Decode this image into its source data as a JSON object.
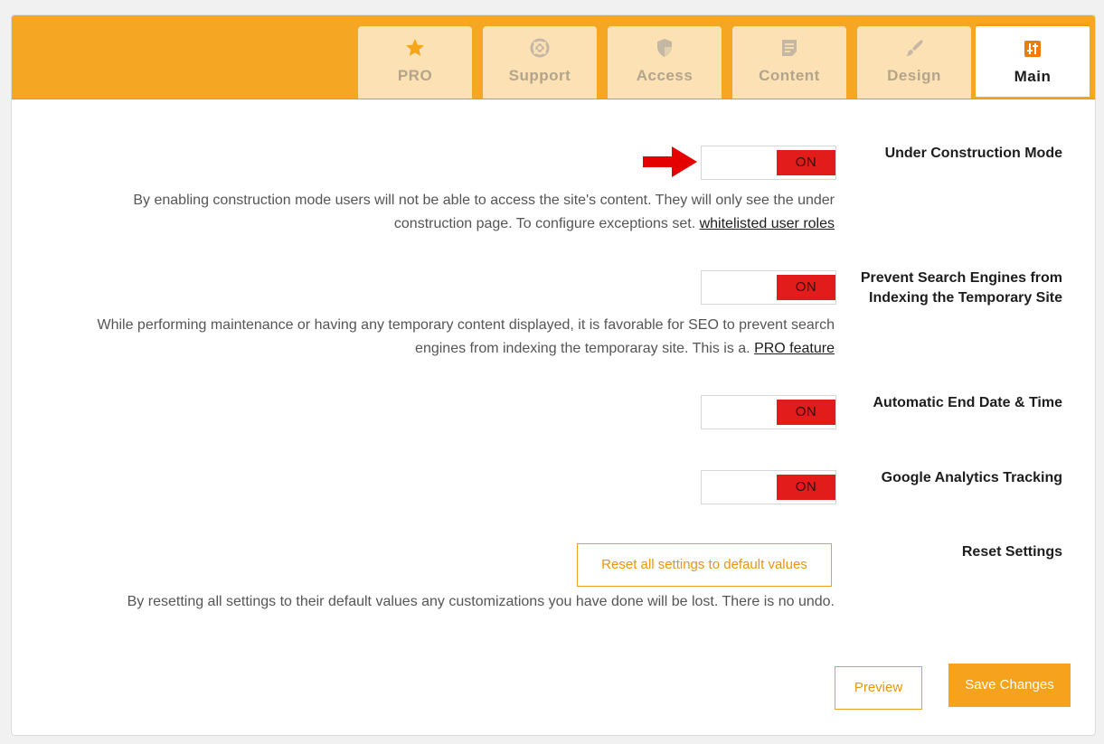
{
  "tabs": [
    {
      "label": "PRO",
      "icon": "star-icon"
    },
    {
      "label": "Support",
      "icon": "lifebuoy-icon"
    },
    {
      "label": "Access",
      "icon": "shield-icon"
    },
    {
      "label": "Content",
      "icon": "document-icon"
    },
    {
      "label": "Design",
      "icon": "brush-icon"
    },
    {
      "label": "Main",
      "icon": "sliders-icon",
      "active": true
    }
  ],
  "settings": {
    "construction": {
      "label": "Under Construction Mode",
      "state": "ON",
      "desc_line1": "By enabling construction mode users will not be able to access the site's content. They will only see the under",
      "desc_line2_text": "construction page. To configure exceptions set",
      "desc_line2_link": "whitelisted user roles"
    },
    "seo": {
      "label_line1": "Prevent Search Engines from",
      "label_line2": "Indexing the Temporary Site",
      "state": "ON",
      "desc_line1": "While performing maintenance or having any temporary content displayed, it is favorable for SEO to prevent search",
      "desc_line2_text": "engines from indexing the temporaray site. This is a",
      "desc_line2_link": "PRO feature"
    },
    "end_date": {
      "label": "Automatic End Date & Time",
      "state": "ON"
    },
    "analytics": {
      "label": "Google Analytics Tracking",
      "state": "ON"
    },
    "reset": {
      "label": "Reset Settings",
      "button": "Reset all settings to default values",
      "desc": "By resetting all settings to their default values any customizations you have done will be lost. There is no undo"
    }
  },
  "actions": {
    "preview": "Preview",
    "save": "Save Changes"
  },
  "colors": {
    "accent": "#f5a623",
    "toggle_on": "#e21b1b",
    "tab_inactive": "#fbe1b3"
  }
}
